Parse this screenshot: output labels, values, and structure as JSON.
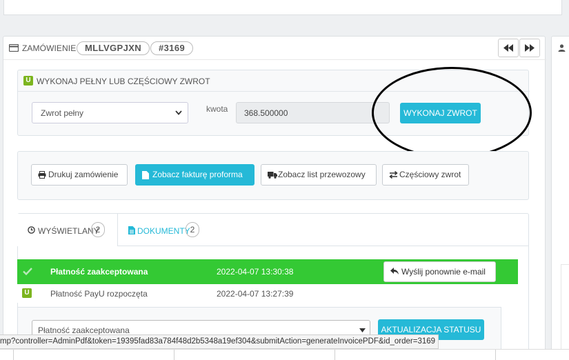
{
  "order": {
    "header_label": "ZAMÓWIENIE",
    "reference": "MLLVGPJXN",
    "id": "#3169"
  },
  "refund": {
    "title": "WYKONAJ PEŁNY LUB CZĘŚCIOWY ZWROT",
    "type_selected": "Zwrot pełny",
    "amount_label": "kwota",
    "amount_value": "368.500000",
    "submit_label": "WYKONAJ ZWROT"
  },
  "actions": {
    "print": "Drukuj zamówienie",
    "proforma": "Zobacz fakturę proforma",
    "shipping": "Zobacz list przewozowy",
    "partial_refund": "Częściowy zwrot"
  },
  "tabs": [
    {
      "label": "WYŚWIETLANY",
      "count": "2"
    },
    {
      "label": "DOKUMENTY",
      "count": "2"
    }
  ],
  "history": [
    {
      "status": "Płatność zaakceptowana",
      "date": "2022-04-07 13:30:38",
      "resend_label": "Wyślij ponownie e-mail"
    },
    {
      "status": "Płatność PayU rozpoczęta",
      "date": "2022-04-07 13:27:39"
    }
  ],
  "status_update": {
    "selected": "Płatność zaakceptowana",
    "button_label": "AKTUALIZACJA STATUSU"
  },
  "status_url": "mp?controller=AdminPdf&token=19395fad83a784f48d2b5348a19ef304&submitAction=generateInvoicePDF&id_order=3169",
  "icons": {
    "payu_letter": "U",
    "order_icon": "credit-card-icon"
  },
  "colors": {
    "primary": "#25b9d7",
    "success_row": "#34c934",
    "payu_green": "#7cb51f"
  }
}
